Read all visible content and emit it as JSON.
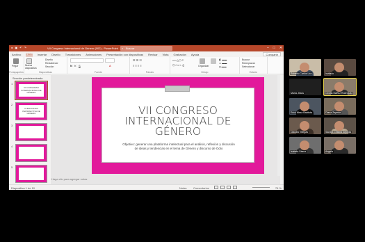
{
  "window": {
    "title": "VII Congreso Internacional de Género (002) - PowerPoint",
    "search_placeholder": "Buscar",
    "share_label": "Compartir"
  },
  "menu": {
    "tabs": [
      "Archivo",
      "Inicio",
      "Insertar",
      "Diseño",
      "Transiciones",
      "Animaciones",
      "Presentación con diapositivas",
      "Revisar",
      "Vista",
      "Grabación",
      "Ayuda"
    ],
    "active_index": 1
  },
  "ribbon": {
    "groups": [
      {
        "label": "Portapapeles",
        "buttons": [
          "Pegar"
        ]
      },
      {
        "label": "Diapositivas",
        "buttons": [
          "Nueva diapositiva",
          "Diseño",
          "Restablecer",
          "Sección"
        ]
      },
      {
        "label": "Fuente",
        "buttons": []
      },
      {
        "label": "Párrafo",
        "buttons": []
      },
      {
        "label": "Dibujo",
        "buttons": [
          "Organizar"
        ]
      },
      {
        "label": "Edición",
        "buttons": [
          "Buscar",
          "Reemplazar",
          "Seleccionar"
        ]
      }
    ]
  },
  "sidebar": {
    "section_label": "Sección predeterminada",
    "thumbnails": [
      {
        "num": "1",
        "text": "VII CONGRESO INTERNACIONAL DE GÉNERO"
      },
      {
        "num": "2",
        "text": "CUESTIONAN PERSPECTIVA DE GÉNERO"
      },
      {
        "num": "3",
        "text": ""
      },
      {
        "num": "4",
        "text": ""
      },
      {
        "num": "5",
        "text": ""
      }
    ],
    "selected_index": 0
  },
  "slide": {
    "title": "VII CONGRESO INTERNACIONAL DE GÉNERO",
    "subtitle": "Objetivo: generar una plataforma intelectual para el análisis, reflexión y discusión de ideas y tendencias en el tema de Género y discurso de Odio",
    "notes_placeholder": "Haga clic para agregar notas"
  },
  "status": {
    "slide_counter": "Diapositiva 1 de 10",
    "notes_label": "Notas",
    "comments_label": "Comentarios",
    "zoom": "76 %"
  },
  "colors": {
    "ppt_accent": "#b7472a",
    "slide_magenta": "#e2199b"
  },
  "participants": [
    {
      "name": "Roberto Carlos Lira"
    },
    {
      "name": "Invitado"
    },
    {
      "name": "María Jesús"
    },
    {
      "name": "Cecilia Ibáñez Rodríguez"
    },
    {
      "name": "Erick Meza Bautista"
    },
    {
      "name": "Diana Zepeda"
    },
    {
      "name": "Claudia Villegas"
    },
    {
      "name": "Sandra Cristina Zepeda"
    },
    {
      "name": "Isabela Sáenz"
    },
    {
      "name": "Angela"
    }
  ]
}
